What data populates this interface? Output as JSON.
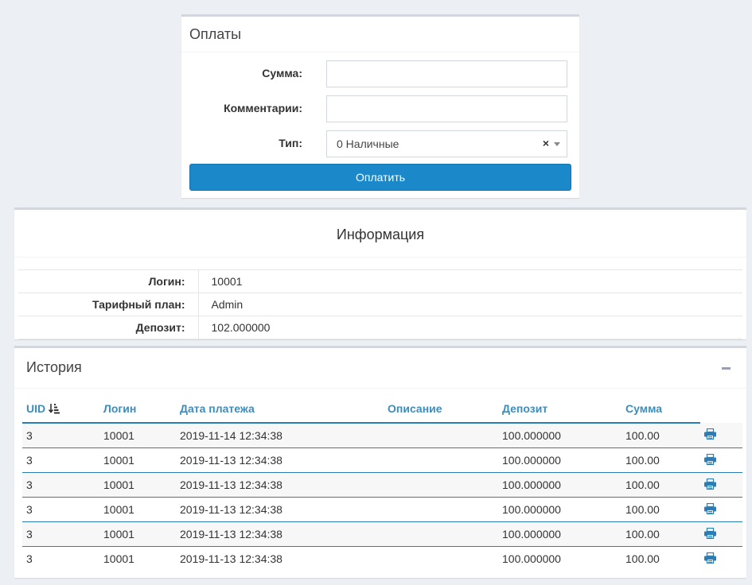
{
  "payments": {
    "title": "Оплаты",
    "sum_label": "Сумма:",
    "sum_value": "",
    "comment_label": "Комментарии:",
    "comment_value": "",
    "type_label": "Тип:",
    "type_value": "0 Наличные",
    "clear_glyph": "×",
    "submit_label": "Оплатить"
  },
  "info": {
    "title": "Информация",
    "rows": [
      {
        "label": "Логин:",
        "value": "10001"
      },
      {
        "label": "Тарифный план:",
        "value": "Admin"
      },
      {
        "label": "Депозит:",
        "value": "102.000000"
      }
    ]
  },
  "history": {
    "title": "История",
    "columns": [
      "UID",
      "Логин",
      "Дата платежа",
      "Описание",
      "Депозит",
      "Сумма"
    ],
    "rows": [
      [
        "3",
        "10001",
        "2019-11-14 12:34:38",
        "",
        "100.000000",
        "100.00"
      ],
      [
        "3",
        "10001",
        "2019-11-13 12:34:38",
        "",
        "100.000000",
        "100.00"
      ],
      [
        "3",
        "10001",
        "2019-11-13 12:34:38",
        "",
        "100.000000",
        "100.00"
      ],
      [
        "3",
        "10001",
        "2019-11-13 12:34:38",
        "",
        "100.000000",
        "100.00"
      ],
      [
        "3",
        "10001",
        "2019-11-13 12:34:38",
        "",
        "100.000000",
        "100.00"
      ],
      [
        "3",
        "10001",
        "2019-11-13 12:34:38",
        "",
        "100.000000",
        "100.00"
      ]
    ],
    "row_action_icon": "print-icon",
    "sort_icon": "sort-amount-desc-icon"
  },
  "colors": {
    "accent": "#1a88c9",
    "link": "#3c8dbc",
    "print_icon": "#2b7db5",
    "background": "#ecf0f5"
  }
}
